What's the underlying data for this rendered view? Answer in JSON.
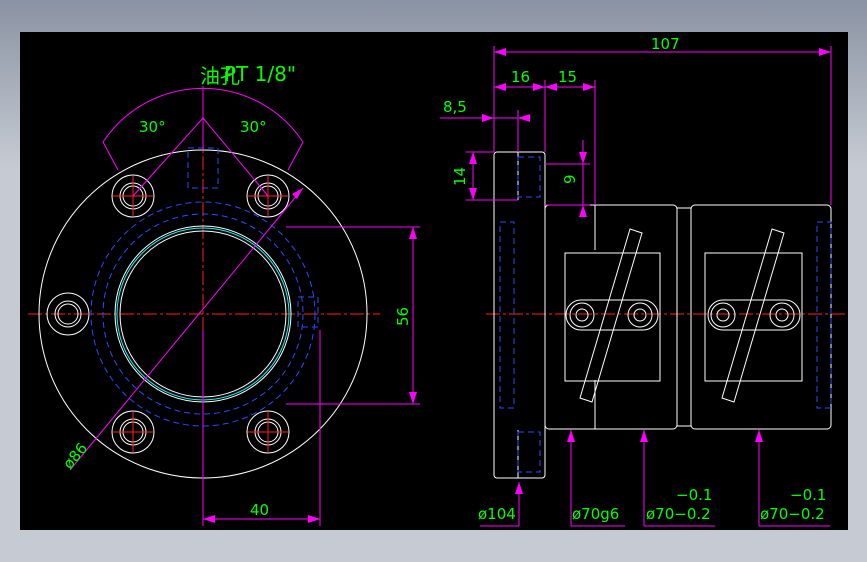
{
  "colors": {
    "background": "#000000",
    "outline": "#ffffff",
    "centerline": "#ff2020",
    "hidden": "#2a4bff",
    "dimension": "#ff00ff",
    "dimension_text": "#00ff00",
    "thread": "#00ffff",
    "frame": "#b9bec6"
  },
  "front_view": {
    "oil_hole_label": "油孔",
    "oil_hole_thread": "PT 1/8\"",
    "angle_left": "30°",
    "angle_right": "30°",
    "dim_height": "56",
    "dim_width": "40",
    "dim_diameter": "ø86"
  },
  "side_view": {
    "dim_overall": "107",
    "dim_16": "16",
    "dim_15": "15",
    "dim_8_5": "8,5",
    "dim_14": "14",
    "dim_9": "9",
    "dim_d104": "ø104",
    "dim_d70g6": "ø70g6",
    "dim_d70_a": "ø70−0.2",
    "dim_tol_a": "−0.1",
    "dim_d70_b": "ø70−0.2",
    "dim_tol_b": "−0.1"
  }
}
